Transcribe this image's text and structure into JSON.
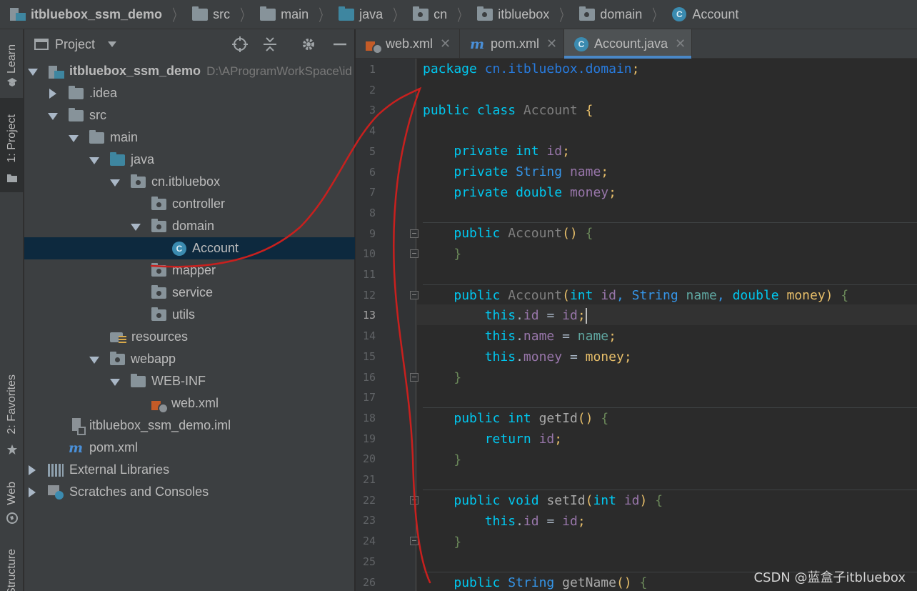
{
  "breadcrumb": [
    {
      "label": "itbluebox_ssm_demo",
      "icon": "project-icon",
      "bold": true
    },
    {
      "label": "src",
      "icon": "folder-icon"
    },
    {
      "label": "main",
      "icon": "folder-icon"
    },
    {
      "label": "java",
      "icon": "source-folder-icon"
    },
    {
      "label": "cn",
      "icon": "package-icon"
    },
    {
      "label": "itbluebox",
      "icon": "package-icon"
    },
    {
      "label": "domain",
      "icon": "package-icon"
    },
    {
      "label": "Account",
      "icon": "class-icon"
    }
  ],
  "toolstrip": {
    "learn": "Learn",
    "project": "1: Project",
    "favorites": "2: Favorites",
    "web": "Web",
    "structure": "Structure"
  },
  "panel": {
    "title": "Project",
    "tree": [
      {
        "label": "itbluebox_ssm_demo",
        "path": "D:\\AProgramWorkSpace\\id",
        "bold": true,
        "expanded": true
      },
      {
        "label": ".idea",
        "expanded": false
      },
      {
        "label": "src",
        "expanded": true
      },
      {
        "label": "main",
        "expanded": true
      },
      {
        "label": "java",
        "expanded": true
      },
      {
        "label": "cn.itbluebox",
        "expanded": true
      },
      {
        "label": "controller"
      },
      {
        "label": "domain",
        "expanded": true
      },
      {
        "label": "Account",
        "selected": true
      },
      {
        "label": "mapper"
      },
      {
        "label": "service"
      },
      {
        "label": "utils"
      },
      {
        "label": "resources"
      },
      {
        "label": "webapp",
        "expanded": true
      },
      {
        "label": "WEB-INF",
        "expanded": true
      },
      {
        "label": "web.xml"
      },
      {
        "label": "itbluebox_ssm_demo.iml"
      },
      {
        "label": "pom.xml"
      },
      {
        "label": "External Libraries",
        "expanded": false
      },
      {
        "label": "Scratches and Consoles",
        "expanded": false
      }
    ]
  },
  "tabs": [
    {
      "label": "web.xml",
      "icon": "xml-icon"
    },
    {
      "label": "pom.xml",
      "icon": "maven-icon"
    },
    {
      "label": "Account.java",
      "icon": "class-icon",
      "active": true
    }
  ],
  "editor": {
    "current_line": 13,
    "line_numbers": [
      "1",
      "2",
      "3",
      "4",
      "5",
      "6",
      "7",
      "8",
      "9",
      "10",
      "11",
      "12",
      "13",
      "14",
      "15",
      "16",
      "17",
      "18",
      "19",
      "20",
      "21",
      "22",
      "23",
      "24",
      "25",
      "26"
    ],
    "code": {
      "l1_kw": "package",
      "l1_pkg": "cn.itbluebox.domain",
      "l3_kw": "public class",
      "l3_name": "Account",
      "l5_kw": "private",
      "l5_type": "int",
      "l5_field": "id",
      "l6_kw": "private",
      "l6_type": "String",
      "l6_field": "name",
      "l7_kw": "private",
      "l7_type": "double",
      "l7_field": "money",
      "l9_kw": "public",
      "l9_name": "Account",
      "l12_kw": "public",
      "l12_name": "Account",
      "l12_t1": "int",
      "l12_p1": "id",
      "l12_t2": "String",
      "l12_p2": "name",
      "l12_t3": "double",
      "l12_p3": "money",
      "this": "this",
      "l13_field": "id",
      "l13_val": "id",
      "l14_field": "name",
      "l14_val": "name",
      "l15_field": "money",
      "l15_val": "money",
      "l18_kw": "public",
      "l18_type": "int",
      "l18_name": "getId",
      "l19_kw": "return",
      "l19_field": "id",
      "l22_kw": "public",
      "l22_type": "void",
      "l22_name": "setId",
      "l22_ptype": "int",
      "l22_param": "id",
      "l23_field": "id",
      "l23_val": "id",
      "l26_kw": "public",
      "l26_type": "String",
      "l26_name": "getName"
    }
  },
  "watermark": "CSDN @蓝盒子itbluebox",
  "colors": {
    "keyword": "#00c8f0",
    "type": "#3595e8",
    "field": "#9876aa",
    "annotation_stroke": "#c8201e",
    "selection": "#0d293e",
    "tab_underline": "#4a88c7"
  }
}
